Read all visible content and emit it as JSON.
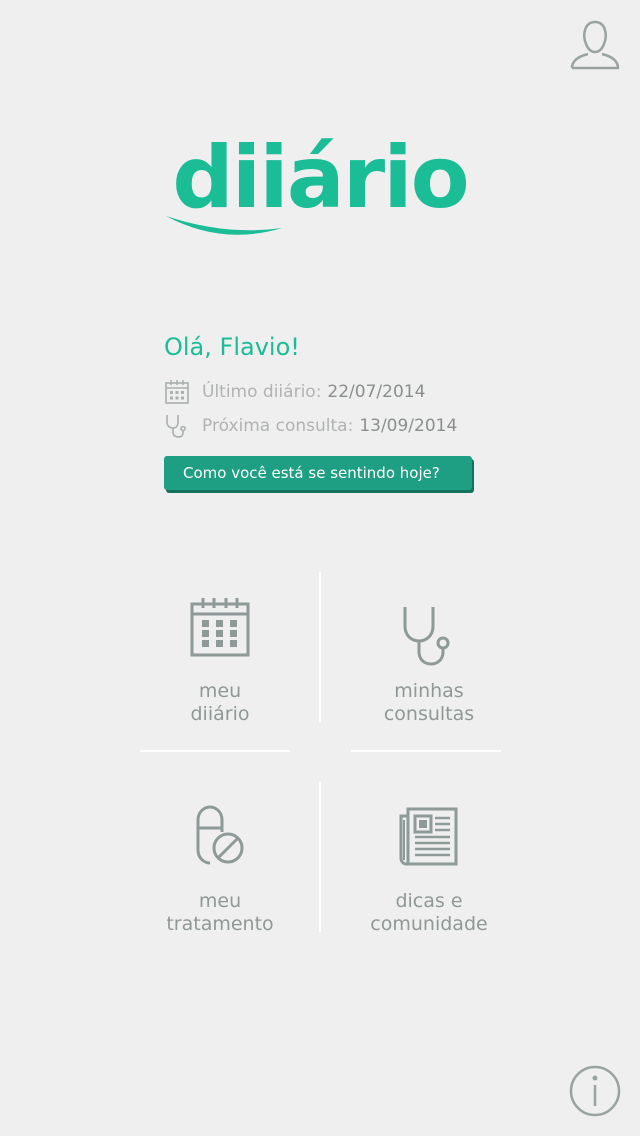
{
  "app": {
    "logo_text": "diiário"
  },
  "greeting": "Olá, Flavio!",
  "last_diary": {
    "label": "Último diiário:",
    "value": "22/07/2014",
    "icon": "calendar-icon"
  },
  "next_appointment": {
    "label": "Próxima consulta:",
    "value": "13/09/2014",
    "icon": "stethoscope-icon"
  },
  "feeling_button": "Como você está se sentindo hoje?",
  "tiles": [
    {
      "line1": "meu",
      "line2": "diiário",
      "icon": "calendar-icon"
    },
    {
      "line1": "minhas",
      "line2": "consultas",
      "icon": "stethoscope-icon"
    },
    {
      "line1": "meu",
      "line2": "tratamento",
      "icon": "pill-icon"
    },
    {
      "line1": "dicas e",
      "line2": "comunidade",
      "icon": "newspaper-icon"
    }
  ],
  "colors": {
    "accent": "#1bbd97",
    "button": "#1e9e82",
    "icon": "#8e9a98",
    "background": "#efefef"
  }
}
